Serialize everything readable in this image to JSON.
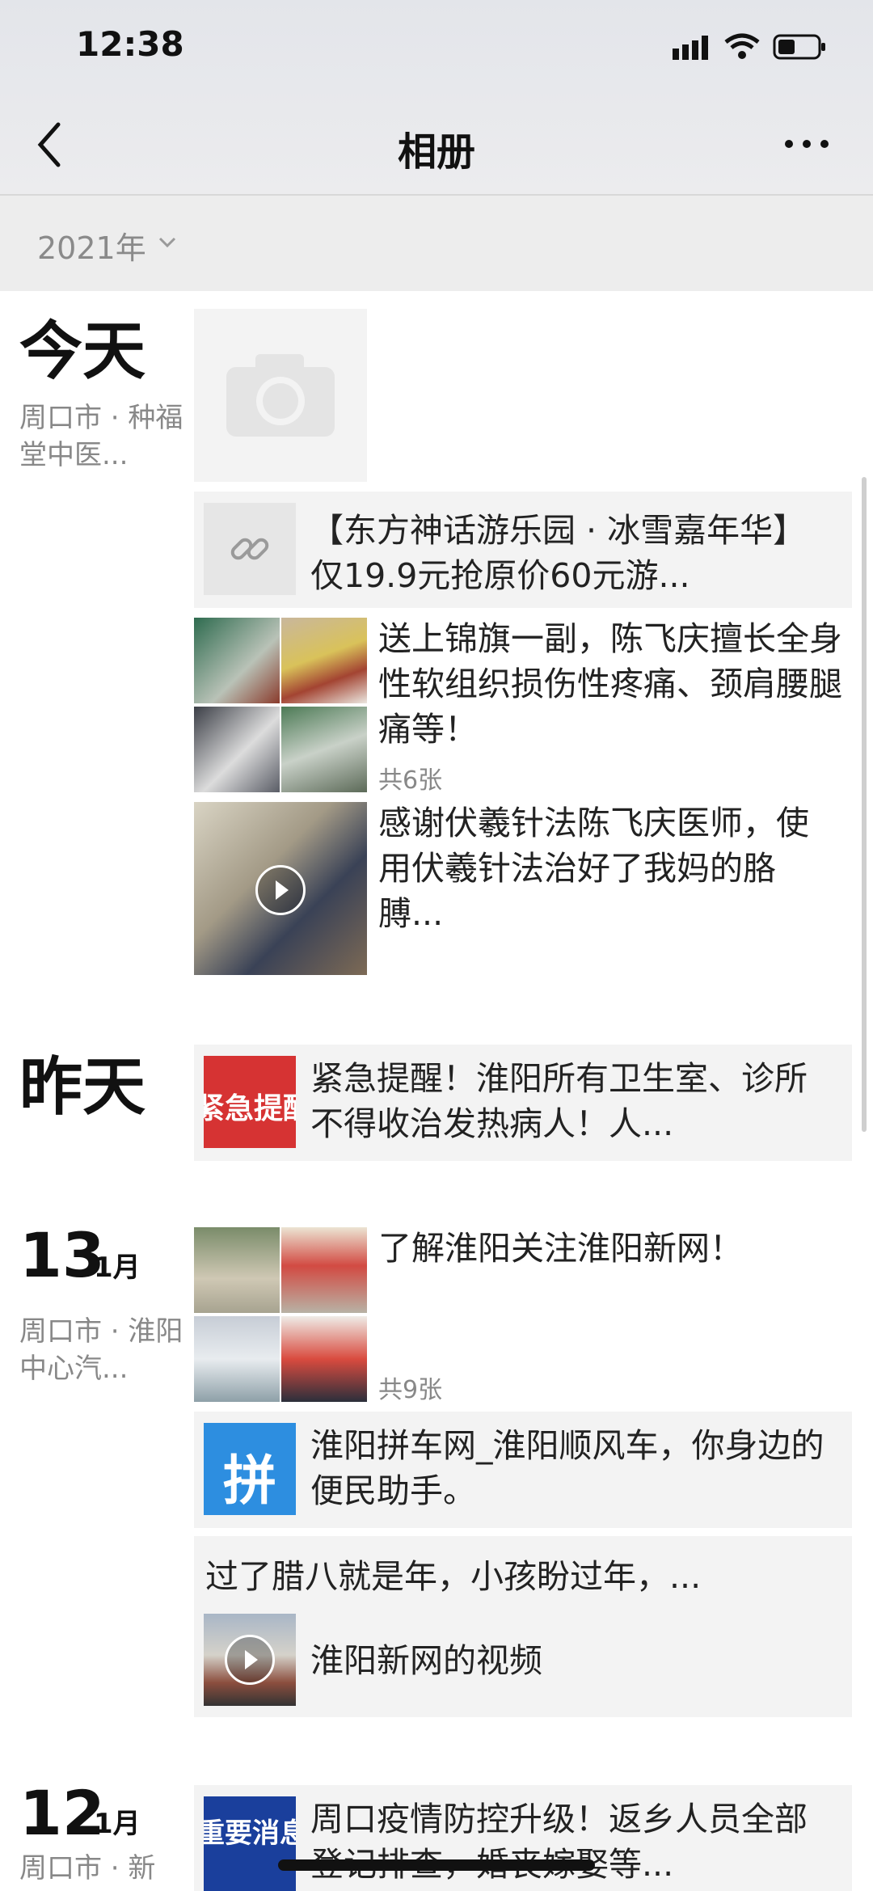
{
  "status": {
    "time": "12:38"
  },
  "nav": {
    "title": "相册"
  },
  "year_filter": {
    "label": "2021年"
  },
  "sections": [
    {
      "day": "今天",
      "location": "周口市 · 种福堂中医...",
      "posts": [
        {
          "kind": "link",
          "text": "【东方神话游乐园 · 冰雪嘉年华】仅19.9元抢原价60元游..."
        },
        {
          "kind": "photos",
          "text": "送上锦旗一副，陈飞庆擅长全身性软组织损伤性疼痛、颈肩腰腿痛等！",
          "count": "共6张"
        },
        {
          "kind": "video",
          "text": "感谢伏羲针法陈飞庆医师，使用伏羲针法治好了我妈的胳膊..."
        }
      ]
    },
    {
      "day": "昨天",
      "posts": [
        {
          "kind": "link",
          "thumb_text": "紧急提醒",
          "text": "紧急提醒！淮阳所有卫生室、诊所不得收治发热病人！人..."
        }
      ]
    },
    {
      "daynum": "13",
      "month": "1月",
      "location": "周口市 · 淮阳中心汽...",
      "posts": [
        {
          "kind": "photos",
          "text": "了解淮阳关注淮阳新网！",
          "count": "共9张"
        },
        {
          "kind": "link",
          "thumb_text": "拼",
          "text": "淮阳拼车网_淮阳顺风车，你身边的便民助手。"
        },
        {
          "kind": "video-share",
          "caption": "过了腊八就是年，小孩盼过年，...",
          "text": "淮阳新网的视频"
        }
      ]
    },
    {
      "daynum": "12",
      "month": "1月",
      "location": "周口市 · 新",
      "posts": [
        {
          "kind": "link",
          "thumb_text": "重要消息",
          "text": "周口疫情防控升级！返乡人员全部登记排查，婚丧嫁娶等..."
        }
      ]
    }
  ],
  "colors": {
    "alert_red": "#d63333",
    "pin_blue": "#2d8ee0",
    "news_blue": "#1a3f9c"
  }
}
